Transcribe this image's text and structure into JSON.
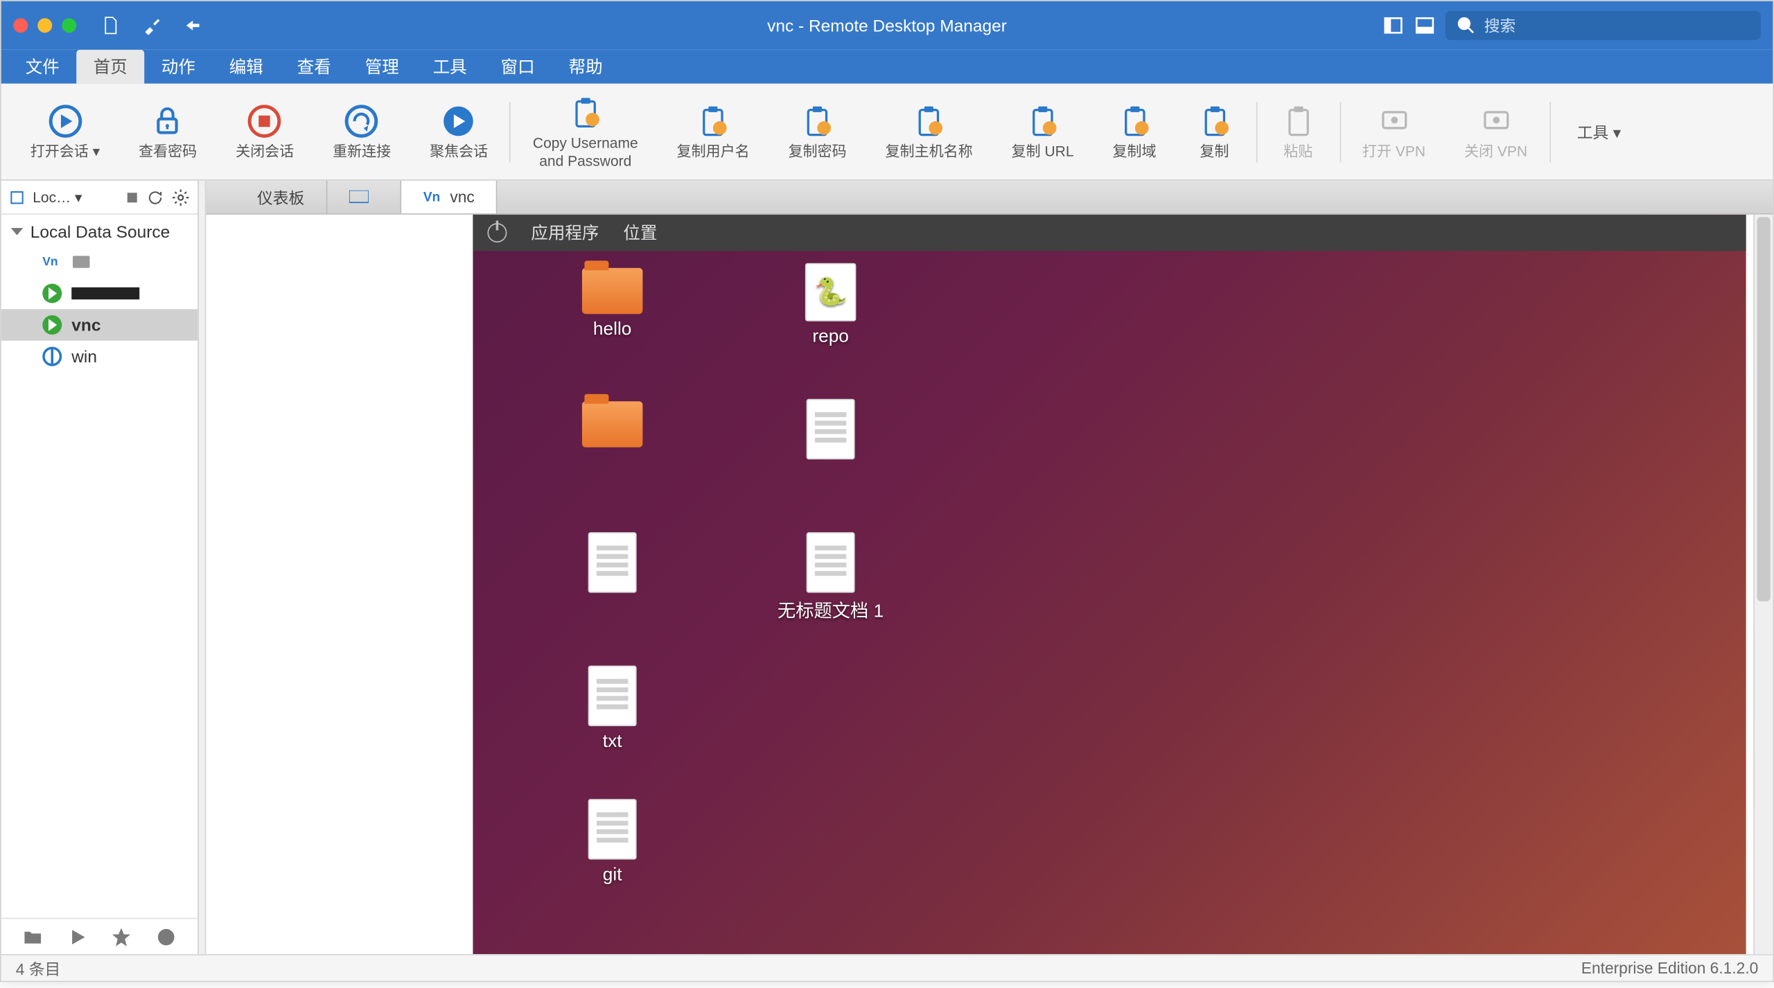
{
  "window": {
    "title": "vnc - Remote Desktop Manager"
  },
  "search": {
    "placeholder": "搜索"
  },
  "menu": {
    "items": [
      {
        "label": "文件",
        "active": false
      },
      {
        "label": "首页",
        "active": true
      },
      {
        "label": "动作",
        "active": false
      },
      {
        "label": "编辑",
        "active": false
      },
      {
        "label": "查看",
        "active": false
      },
      {
        "label": "管理",
        "active": false
      },
      {
        "label": "工具",
        "active": false
      },
      {
        "label": "窗口",
        "active": false
      },
      {
        "label": "帮助",
        "active": false
      }
    ]
  },
  "ribbon": {
    "buttons": [
      {
        "label": "打开会话 ▾",
        "icon": "play",
        "disabled": false
      },
      {
        "label": "查看密码",
        "icon": "lock",
        "disabled": false
      },
      {
        "label": "关闭会话",
        "icon": "stop",
        "disabled": false
      },
      {
        "label": "重新连接",
        "icon": "reconnect",
        "disabled": false
      },
      {
        "label": "聚焦会话",
        "icon": "focus",
        "disabled": false
      },
      {
        "label": "Copy Username\nand Password",
        "icon": "clip-user",
        "disabled": false
      },
      {
        "label": "复制用户名",
        "icon": "clip-user2",
        "disabled": false
      },
      {
        "label": "复制密码",
        "icon": "clip-lock",
        "disabled": false
      },
      {
        "label": "复制主机名称",
        "icon": "clip-host",
        "disabled": false
      },
      {
        "label": "复制 URL",
        "icon": "clip-url",
        "disabled": false
      },
      {
        "label": "复制域",
        "icon": "clip-domain",
        "disabled": false
      },
      {
        "label": "复制",
        "icon": "clip",
        "disabled": false
      },
      {
        "label": "粘贴",
        "icon": "paste",
        "disabled": true
      },
      {
        "label": "打开 VPN",
        "icon": "vpn-open",
        "disabled": true
      },
      {
        "label": "关闭 VPN",
        "icon": "vpn-close",
        "disabled": true
      }
    ],
    "tools_label": "工具 ▾"
  },
  "sidebar": {
    "head_label": "Loc… ▾",
    "group": "Local Data Source",
    "items": [
      {
        "icon": "vnc",
        "label": ""
      },
      {
        "icon": "play",
        "label": ""
      },
      {
        "icon": "play",
        "label": "vnc",
        "selected": true
      },
      {
        "icon": "globe",
        "label": "win"
      }
    ]
  },
  "tabs": [
    {
      "label": "仪表板",
      "icon": "dash",
      "active": false
    },
    {
      "label": "",
      "icon": "host",
      "active": false
    },
    {
      "label": "vnc",
      "icon": "vnc",
      "active": true
    }
  ],
  "remote": {
    "menu": {
      "apps": "应用程序",
      "places": "位置"
    },
    "icons": [
      {
        "type": "folder",
        "label": "hello"
      },
      {
        "type": "python",
        "label": "repo"
      },
      {
        "type": "folder",
        "label": ""
      },
      {
        "type": "file",
        "label": ""
      },
      {
        "type": "file",
        "label": ""
      },
      {
        "type": "file",
        "label": "无标题文档 1"
      },
      {
        "type": "file",
        "label": "txt"
      },
      {
        "type": "empty",
        "label": ""
      },
      {
        "type": "file",
        "label": "git"
      }
    ]
  },
  "status": {
    "left": "4 条目",
    "right": "Enterprise Edition 6.1.2.0"
  }
}
